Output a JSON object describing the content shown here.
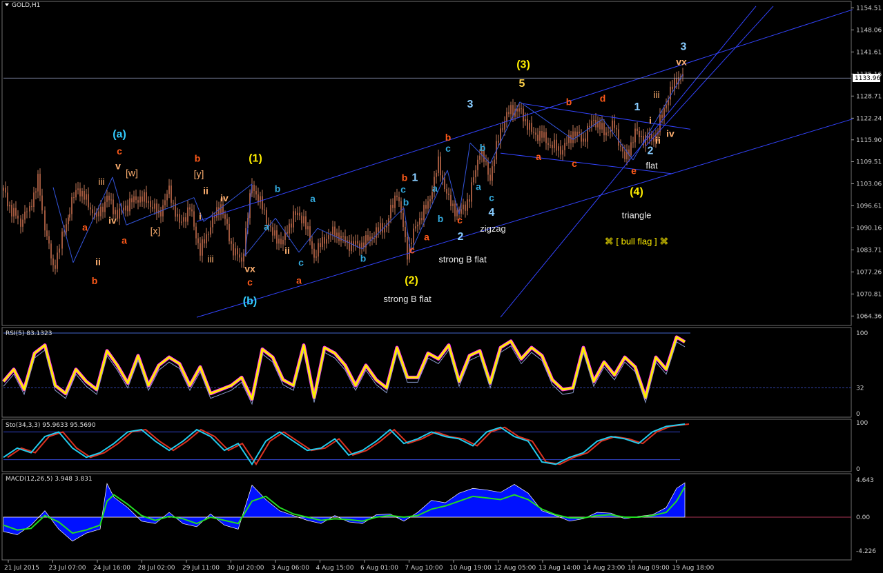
{
  "window": {
    "symbol_title": "GOLD,H1",
    "menu_icon": "triangle-down-icon"
  },
  "chart_data": [
    {
      "type": "line",
      "pane": "price",
      "title": "GOLD,H1",
      "current_price_label": "1133.96",
      "current_price": 1133.96,
      "y_ticks": [
        "1154.51",
        "1148.06",
        "1141.61",
        "1135.16",
        "1128.71",
        "1122.24",
        "1115.90",
        "1109.51",
        "1103.06",
        "1096.61",
        "1090.16",
        "1083.71",
        "1077.26",
        "1070.81",
        "1064.36"
      ],
      "ylim": [
        1062.0,
        1156.0
      ],
      "x_ticks": [
        "21 Jul 2015",
        "23 Jul 07:00",
        "24 Jul 16:00",
        "28 Jul 02:00",
        "29 Jul 11:00",
        "30 Jul 20:00",
        "3 Aug 06:00",
        "4 Aug 15:00",
        "6 Aug 01:00",
        "7 Aug 10:00",
        "10 Aug 19:00",
        "12 Aug 05:00",
        "13 Aug 14:00",
        "14 Aug 23:00",
        "18 Aug 09:00",
        "19 Aug 18:00"
      ],
      "x": [
        0,
        12,
        25,
        38,
        50,
        60,
        72,
        85,
        96,
        108,
        120,
        135,
        150,
        165,
        180,
        195,
        210,
        225,
        240,
        255,
        270,
        285,
        300,
        315,
        330,
        345,
        360,
        375,
        390,
        405,
        420,
        435,
        450,
        465,
        480,
        495,
        510,
        525,
        540,
        555,
        570,
        585,
        600,
        615,
        630,
        645,
        660,
        675,
        690,
        705,
        720,
        735,
        750,
        765,
        780,
        795,
        810,
        825,
        840,
        855,
        870,
        885,
        900,
        915,
        930,
        945,
        960,
        975,
        987
      ],
      "close": [
        1101,
        1095,
        1092,
        1096,
        1104,
        1091,
        1078,
        1087,
        1096,
        1102,
        1098,
        1093,
        1099,
        1094,
        1097,
        1099,
        1098,
        1094,
        1101,
        1091,
        1096,
        1083,
        1091,
        1097,
        1085,
        1080,
        1103,
        1096,
        1088,
        1086,
        1094,
        1093,
        1082,
        1087,
        1089,
        1086,
        1085,
        1086,
        1089,
        1091,
        1101,
        1083,
        1092,
        1097,
        1109,
        1098,
        1094,
        1099,
        1113,
        1105,
        1119,
        1125,
        1124,
        1118,
        1117,
        1114,
        1113,
        1118,
        1116,
        1122,
        1118,
        1120,
        1110,
        1118,
        1116,
        1117,
        1127,
        1134,
        1135
      ],
      "annotations": [
        {
          "text": "(a)",
          "x": 168,
          "price": 1116.6,
          "color": "#33ccff"
        },
        {
          "text": "c",
          "x": 168,
          "price": 1111.6,
          "color": "#ff5a1a"
        },
        {
          "text": "v",
          "x": 166,
          "price": 1107.3,
          "color": "#ffb070"
        },
        {
          "text": "[w]",
          "x": 186,
          "price": 1105.3,
          "color": "#ffb070"
        },
        {
          "text": "iii",
          "x": 142,
          "price": 1102.7,
          "color": "#ffb070"
        },
        {
          "text": "iv",
          "x": 158,
          "price": 1091.4,
          "color": "#ffb070"
        },
        {
          "text": "a",
          "x": 118,
          "price": 1089.3,
          "color": "#ff5a1a"
        },
        {
          "text": "a",
          "x": 175,
          "price": 1085.5,
          "color": "#ff5a1a"
        },
        {
          "text": "[x]",
          "x": 220,
          "price": 1088.3,
          "color": "#ffb070"
        },
        {
          "text": "ii",
          "x": 137,
          "price": 1079.2,
          "color": "#ffb070"
        },
        {
          "text": "b",
          "x": 132,
          "price": 1073.7,
          "color": "#ff5a1a"
        },
        {
          "text": "b",
          "x": 281,
          "price": 1109.5,
          "color": "#ff5a1a"
        },
        {
          "text": "[y]",
          "x": 283,
          "price": 1105.0,
          "color": "#ffb070"
        },
        {
          "text": "ii",
          "x": 293,
          "price": 1100.0,
          "color": "#ffb070"
        },
        {
          "text": "iv",
          "x": 320,
          "price": 1097.9,
          "color": "#ffb070"
        },
        {
          "text": "i",
          "x": 285,
          "price": 1092.6,
          "color": "#ffb070"
        },
        {
          "text": "iii",
          "x": 300,
          "price": 1080.1,
          "color": "#ffb070"
        },
        {
          "text": "vx",
          "x": 357,
          "price": 1077.2,
          "color": "#ffb070"
        },
        {
          "text": "c",
          "x": 357,
          "price": 1073.3,
          "color": "#ff5a1a"
        },
        {
          "text": "(b)",
          "x": 357,
          "price": 1067.7,
          "color": "#33ccff"
        },
        {
          "text": "(1)",
          "x": 365,
          "price": 1109.5,
          "color": "#ffee00"
        },
        {
          "text": "b",
          "x": 397,
          "price": 1100.6,
          "color": "#33aadd"
        },
        {
          "text": "a",
          "x": 448,
          "price": 1097.7,
          "color": "#33aadd"
        },
        {
          "text": "a",
          "x": 381,
          "price": 1089.5,
          "color": "#33aadd"
        },
        {
          "text": "ii",
          "x": 411,
          "price": 1082.6,
          "color": "#ffb070"
        },
        {
          "text": "c",
          "x": 431,
          "price": 1079.0,
          "color": "#33aadd"
        },
        {
          "text": "a",
          "x": 428,
          "price": 1073.8,
          "color": "#ff5a1a"
        },
        {
          "text": "b",
          "x": 521,
          "price": 1080.3,
          "color": "#33aadd"
        },
        {
          "text": "b",
          "x": 581,
          "price": 1103.9,
          "color": "#ff5a1a"
        },
        {
          "text": "1",
          "x": 596,
          "price": 1103.9,
          "color": "#88ccff"
        },
        {
          "text": "c",
          "x": 579,
          "price": 1100.4,
          "color": "#33aadd"
        },
        {
          "text": "b",
          "x": 583,
          "price": 1096.7,
          "color": "#33aadd"
        },
        {
          "text": "a",
          "x": 625,
          "price": 1100.7,
          "color": "#33aadd"
        },
        {
          "text": "a",
          "x": 613,
          "price": 1086.5,
          "color": "#ff5a1a"
        },
        {
          "text": "c",
          "x": 592,
          "price": 1082.7,
          "color": "#ff5a1a"
        },
        {
          "text": "(2)",
          "x": 591,
          "price": 1073.8,
          "color": "#ffee00"
        },
        {
          "text": "strong B flat",
          "x": 585,
          "price": 1068.5,
          "color": "#e8e8e8"
        },
        {
          "text": "strong B flat",
          "x": 665,
          "price": 1080.1,
          "color": "#e8e8e8"
        },
        {
          "text": "b",
          "x": 633,
          "price": 1091.9,
          "color": "#33aadd"
        },
        {
          "text": "c",
          "x": 661,
          "price": 1091.5,
          "color": "#ff5a1a"
        },
        {
          "text": "2",
          "x": 662,
          "price": 1086.6,
          "color": "#88ccff"
        },
        {
          "text": "zigzag",
          "x": 709,
          "price": 1089.0,
          "color": "#e8e8e8"
        },
        {
          "text": "3",
          "x": 676,
          "price": 1125.3,
          "color": "#88ccff"
        },
        {
          "text": "b",
          "x": 644,
          "price": 1115.7,
          "color": "#ff5a1a"
        },
        {
          "text": "c",
          "x": 644,
          "price": 1112.4,
          "color": "#33aadd"
        },
        {
          "text": "b",
          "x": 694,
          "price": 1112.6,
          "color": "#33aadd"
        },
        {
          "text": "a",
          "x": 688,
          "price": 1101.2,
          "color": "#33aadd"
        },
        {
          "text": "c",
          "x": 707,
          "price": 1098.0,
          "color": "#33aadd"
        },
        {
          "text": "4",
          "x": 707,
          "price": 1093.7,
          "color": "#88ccff"
        },
        {
          "text": "(3)",
          "x": 753,
          "price": 1136.9,
          "color": "#ffee00"
        },
        {
          "text": "5",
          "x": 751,
          "price": 1131.4,
          "color": "#ffd24a"
        },
        {
          "text": "b",
          "x": 819,
          "price": 1126.0,
          "color": "#ff5a1a"
        },
        {
          "text": "d",
          "x": 868,
          "price": 1127.1,
          "color": "#ff5a1a"
        },
        {
          "text": "a",
          "x": 775,
          "price": 1110.0,
          "color": "#ff5a1a"
        },
        {
          "text": "c",
          "x": 827,
          "price": 1108.0,
          "color": "#ff5a1a"
        },
        {
          "text": "1",
          "x": 918,
          "price": 1124.5,
          "color": "#88ccff"
        },
        {
          "text": "iii",
          "x": 946,
          "price": 1128.2,
          "color": "#ffb070"
        },
        {
          "text": "i",
          "x": 937,
          "price": 1120.6,
          "color": "#ffb070"
        },
        {
          "text": "iv",
          "x": 966,
          "price": 1116.8,
          "color": "#ffb070"
        },
        {
          "text": "ii",
          "x": 948,
          "price": 1114.7,
          "color": "#ffb070"
        },
        {
          "text": "2",
          "x": 937,
          "price": 1111.7,
          "color": "#88ccff"
        },
        {
          "text": "flat",
          "x": 939,
          "price": 1107.5,
          "color": "#e8e8e8"
        },
        {
          "text": "e",
          "x": 913,
          "price": 1105.9,
          "color": "#ff5a1a"
        },
        {
          "text": "(4)",
          "x": 917,
          "price": 1099.7,
          "color": "#ffee00"
        },
        {
          "text": "triangle",
          "x": 917,
          "price": 1093.0,
          "color": "#e8e8e8"
        },
        {
          "text": "⌘ [ bull flag ] ⌘",
          "x": 917,
          "price": 1085.3,
          "color": "#ffee00"
        },
        {
          "text": "3",
          "x": 985,
          "price": 1142.2,
          "color": "#88ccff"
        },
        {
          "text": "vx",
          "x": 982,
          "price": 1137.7,
          "color": "#ffb070"
        }
      ]
    },
    {
      "type": "line",
      "pane": "rsi",
      "title": "RSI(5) 83.1323",
      "current_value": 83.1323,
      "y_ticks": [
        "100",
        "32",
        "0"
      ],
      "ylim": [
        0,
        100
      ],
      "level": 32,
      "x": [
        0,
        15,
        30,
        45,
        60,
        75,
        90,
        105,
        120,
        135,
        150,
        165,
        180,
        195,
        210,
        225,
        240,
        255,
        270,
        285,
        300,
        315,
        330,
        345,
        360,
        375,
        390,
        405,
        420,
        435,
        450,
        465,
        480,
        495,
        510,
        525,
        540,
        555,
        570,
        585,
        600,
        615,
        630,
        645,
        660,
        675,
        690,
        705,
        720,
        735,
        750,
        765,
        780,
        795,
        810,
        825,
        840,
        855,
        870,
        885,
        900,
        915,
        930,
        945,
        960,
        975,
        987
      ],
      "values": [
        40,
        55,
        30,
        75,
        85,
        35,
        25,
        55,
        40,
        30,
        78,
        60,
        38,
        72,
        35,
        60,
        70,
        62,
        35,
        58,
        25,
        30,
        35,
        45,
        18,
        80,
        70,
        42,
        35,
        85,
        20,
        82,
        75,
        60,
        35,
        60,
        42,
        32,
        82,
        45,
        45,
        75,
        68,
        85,
        40,
        72,
        78,
        38,
        82,
        90,
        68,
        82,
        72,
        42,
        30,
        32,
        82,
        40,
        64,
        48,
        70,
        58,
        20,
        70,
        55,
        95,
        89
      ]
    },
    {
      "type": "line",
      "pane": "stochastic",
      "title": "Sto(34,3,3) 95.9633 95.5690",
      "main_value": 95.9633,
      "signal_value": 95.569,
      "y_ticks": [
        "100",
        "0"
      ],
      "ylim": [
        0,
        100
      ],
      "x": [
        0,
        20,
        40,
        60,
        80,
        100,
        120,
        140,
        160,
        180,
        200,
        220,
        240,
        260,
        280,
        300,
        320,
        340,
        360,
        380,
        400,
        420,
        440,
        460,
        480,
        500,
        520,
        540,
        560,
        580,
        600,
        620,
        640,
        660,
        680,
        700,
        720,
        740,
        760,
        780,
        800,
        820,
        840,
        860,
        880,
        900,
        920,
        940,
        960,
        987
      ],
      "values": [
        25,
        45,
        35,
        70,
        80,
        45,
        25,
        35,
        55,
        80,
        85,
        60,
        40,
        60,
        85,
        70,
        40,
        55,
        10,
        60,
        80,
        60,
        40,
        45,
        65,
        30,
        40,
        60,
        85,
        55,
        65,
        80,
        70,
        65,
        50,
        80,
        90,
        70,
        60,
        15,
        10,
        25,
        35,
        60,
        70,
        65,
        55,
        80,
        92,
        97
      ]
    },
    {
      "type": "area",
      "pane": "macd",
      "title": "MACD(12,26,5) 3.948 3.831",
      "macd_value": 3.948,
      "signal_value": 3.831,
      "y_ticks": [
        "4.643",
        "0.00",
        "-4.226"
      ],
      "ylim": [
        -5.0,
        5.0
      ],
      "x": [
        0,
        20,
        40,
        60,
        80,
        100,
        120,
        140,
        150,
        160,
        180,
        200,
        220,
        240,
        260,
        280,
        300,
        320,
        340,
        360,
        380,
        400,
        420,
        440,
        460,
        480,
        500,
        520,
        540,
        560,
        580,
        600,
        620,
        640,
        660,
        680,
        700,
        720,
        740,
        760,
        780,
        800,
        820,
        840,
        860,
        880,
        900,
        920,
        940,
        960,
        975,
        987
      ],
      "histogram": [
        -1.8,
        -2.2,
        -1.0,
        0.8,
        -1.5,
        -3.0,
        -2.0,
        -1.5,
        4.2,
        2.5,
        1.2,
        -0.5,
        -0.8,
        0.6,
        -0.8,
        -1.2,
        0.4,
        -1.0,
        -1.5,
        4.0,
        2.2,
        0.8,
        0.2,
        -0.4,
        -0.8,
        0.2,
        -0.6,
        -0.8,
        0.3,
        0.4,
        -0.5,
        0.6,
        2.1,
        1.8,
        3.0,
        3.6,
        3.4,
        3.1,
        4.1,
        3.0,
        0.8,
        0.2,
        -0.5,
        -0.2,
        0.6,
        0.5,
        -0.2,
        0.1,
        0.3,
        1.2,
        3.6,
        4.3
      ],
      "signal": [
        -1.0,
        -1.6,
        -1.4,
        0.2,
        -0.6,
        -2.0,
        -1.6,
        -1.0,
        2.0,
        2.8,
        1.6,
        0.2,
        -0.4,
        0.1,
        -0.2,
        -0.8,
        0.0,
        -0.4,
        -0.8,
        2.0,
        2.6,
        1.2,
        0.4,
        0.0,
        -0.4,
        -0.2,
        -0.3,
        -0.5,
        0.0,
        0.2,
        0.0,
        0.2,
        1.0,
        1.4,
        2.0,
        2.6,
        2.4,
        2.2,
        2.8,
        2.2,
        1.0,
        0.3,
        -0.1,
        -0.1,
        0.2,
        0.3,
        0.0,
        0.0,
        0.2,
        0.6,
        2.0,
        3.8
      ]
    }
  ]
}
